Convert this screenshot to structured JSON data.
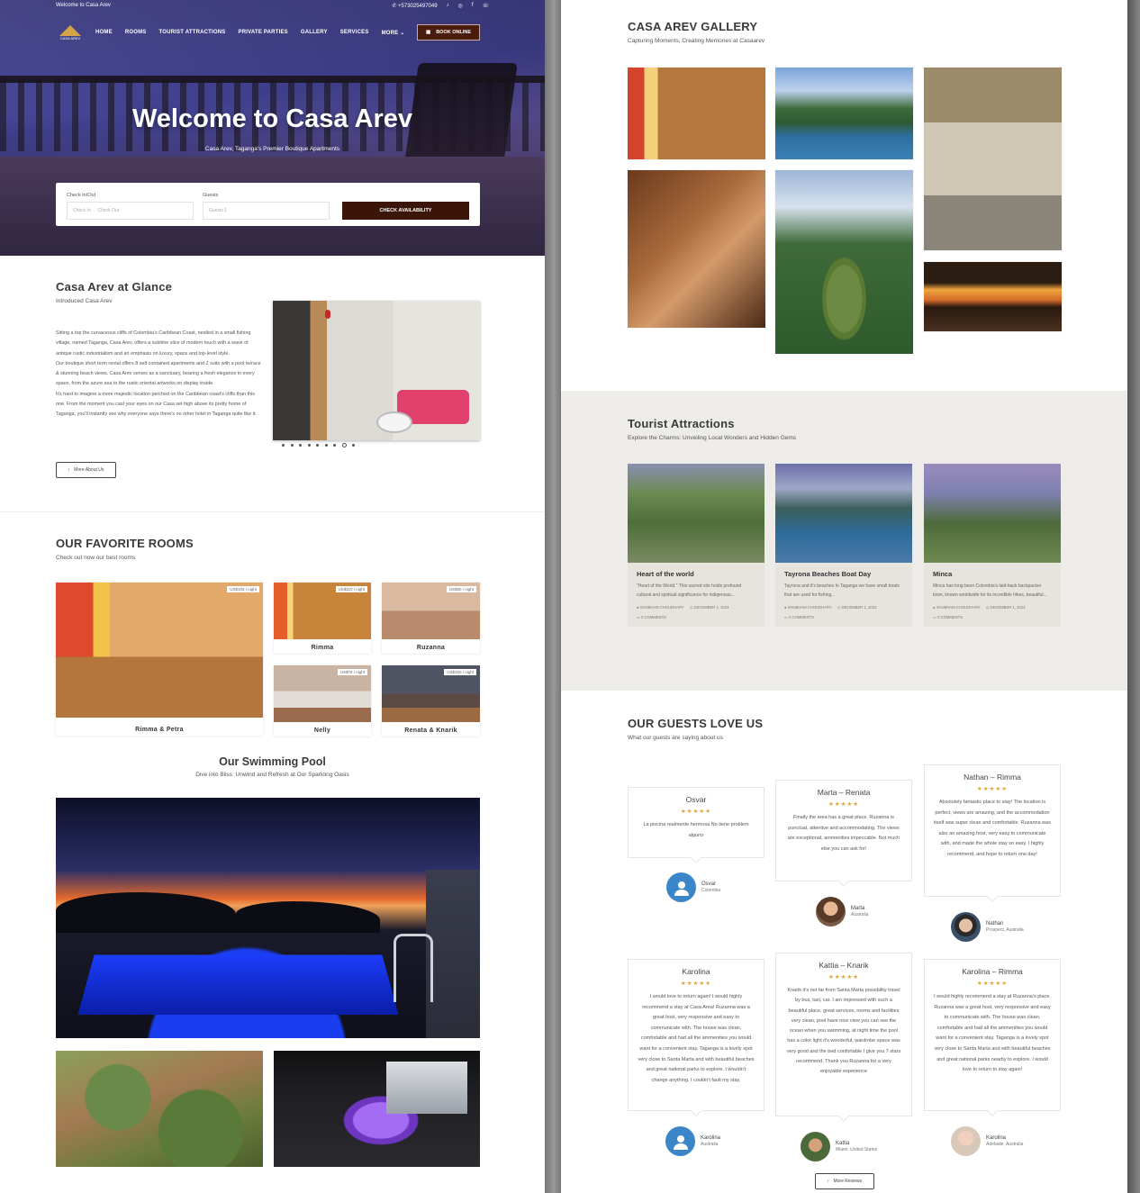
{
  "topbar": {
    "welcome": "Welcome to Casa Arev",
    "phone": "+573025497049",
    "social_icons": [
      "tiktok-icon",
      "instagram-icon",
      "facebook-icon",
      "whatsapp-icon"
    ]
  },
  "nav": {
    "logo_text": "CASA AREV",
    "items": [
      {
        "label": "HOME"
      },
      {
        "label": "ROOMS"
      },
      {
        "label": "TOURIST ATTRACTIONS"
      },
      {
        "label": "PRIVATE PARTIES"
      },
      {
        "label": "GALLERY"
      },
      {
        "label": "SERVICES"
      },
      {
        "label": "MORE"
      }
    ],
    "book_label": "BOOK ONLINE"
  },
  "hero": {
    "title": "Welcome to Casa Arev",
    "subtitle": "Casa Arev, Taganga's Premier Boutique Apartments"
  },
  "booking": {
    "checkin_label": "Check In/Out",
    "checkin_placeholder": "Check In → Check Out",
    "guests_label": "Guests",
    "guests_value": "Guests 1",
    "check_button": "CHECK AVAILABILITY"
  },
  "glance": {
    "title": "Casa Arev at Glance",
    "subtitle": "Introduced Casa Arev",
    "text": "Sitting a top the curvaceous cliffs of Colombia's Caribbean Coast, nestled in a small fishing village, named Taganga, Casa Arev, offers a sublime slice of modern touch with a wave of antique rustic industrialism and an emphasis on luxury, space and top-level style.\nOur boutique short term rental offers 8 self contained apartments and 2 suits with a pool terrace & stunning beach views. Casa Arev serves as a sanctuary, bearing a fresh elegance in every space, from the azure sea to the rustic oriental artworks on display inside.\nIt's hard to imagine a more majestic location perched on the Caribbean coast's cliffs than this one. From the moment you cast your eyes on our Casa set high above its pretty home of Taganga, you'll instantly see why everyone says there's no other hotel in Taganga quite like it.",
    "carousel_dots": 9,
    "carousel_active": 7,
    "more_button": "More About Us"
  },
  "rooms": {
    "title": "OUR FAVORITE ROOMS",
    "subtitle": "Check out now our best rooms",
    "items": [
      {
        "name": "Rimma & Petra",
        "price": "US$105 / night"
      },
      {
        "name": "Rimma",
        "price": "US$110 / night"
      },
      {
        "name": "Ruzanna",
        "price": "US$90 / night"
      },
      {
        "name": "Nelly",
        "price": "US$75 / night"
      },
      {
        "name": "Renata & Knarik",
        "price": "US$160 / night"
      }
    ]
  },
  "pool": {
    "title": "Our Swimming Pool",
    "subtitle": "Dive into Bliss: Unwind and Refresh at Our Sparkling Oasis"
  },
  "gallery": {
    "title": "CASA AREV GALLERY",
    "subtitle": "Capturing Moments, Creating Memories at Casaarev"
  },
  "attractions": {
    "title": "Tourist Attractions",
    "subtitle": "Explore the Charms: Unveiling Local Wonders and Hidden Gems",
    "cards": [
      {
        "title": "Heart of the world",
        "excerpt": "\"Heart of the World.\" This sacred site holds profound cultural and spiritual significance for indigenous...",
        "author": "SHUBHAM CHOUDHARY",
        "date": "DECEMBER 1, 2023",
        "comments": "0 COMMENTS"
      },
      {
        "title": "Tayrona Beaches Boat Day",
        "excerpt": "Tayrona and it's beaches In Taganga we have small boats that are used for fishing...",
        "author": "SHUBHAM CHOUDHARY",
        "date": "DECEMBER 1, 2023",
        "comments": "0 COMMENTS"
      },
      {
        "title": "Minca",
        "excerpt": "Minca has long been Colombia's laid-back backpacker town, known worldwide for its incredible hikes, beautiful...",
        "author": "SHUBHAM CHOUDHARY",
        "date": "DECEMBER 1, 2023",
        "comments": "0 COMMENTS"
      }
    ]
  },
  "guests": {
    "title": "OUR GUESTS LOVE US",
    "subtitle": "What our guests are saying about us",
    "reviews": [
      {
        "who": "Osvar",
        "text": "La piscina realmente hermosa No tiene problem alguno",
        "name": "Osvar",
        "location": "Colombia"
      },
      {
        "who": "Marta – Renata",
        "text": "Finally the area has a great place. Ruzanna is punctual, attentive and accommodating. The views are exceptional, ammenities impeccable. Not much else you can ask for!",
        "name": "Marta",
        "location": "Australia"
      },
      {
        "who": "Nathan – Rimma",
        "text": "Absolutely fantastic place to stay! The location is perfect, views are amazing, and the accommodation itself was super clean and comfortable. Ruzanna was also an amazing host, very easy to communicate with, and made the whole stay so easy. I highly recommend, and hope to return one day!",
        "name": "Nathan",
        "location": "Prospect, Australia"
      },
      {
        "who": "Karolina",
        "text": "I would love to return again! I would highly recommend a stay at Casa Area! Ruzanna was a great host, very responsive and easy to communicate with. The house was clean, comfortable and had all the ammenities you would want for a convenient stay. Taganga is a lovely spot very close to Santa Marta and with beautiful beaches and great national parks to explore. I wouldn't change anything. I couldn't fault my stay.",
        "name": "Karolina",
        "location": "Australia"
      },
      {
        "who": "Kattia – Knarik",
        "text": "Knarik it's not far from Santa Marta possibility travel by bus, taxi, car. I am impressed with such a beautiful place, great services, rooms and facilities very clean, pool have nice view you can see the ocean when you swimming, at night time the pool has a color light it's wonderful, wardrobe space was very good and the bed confortable I give you 7 stars recommend. Thank you Ruzanna for a very enjoyable experience",
        "name": "Kattia",
        "location": "Miami, United States"
      },
      {
        "who": "Karolina – Rimma",
        "text": "I would highly recommend a stay at Ruzanna's place. Ruzanna was a great host, very responsive and easy to communicate with. The house was clean, comfortable and had all the ammenities you would want for a convenient stay. Taganga is a lovely spot very close to Santa Marta and with beautiful beaches and great national parks nearby to explore. I would love to return to stay again!",
        "name": "Karolina",
        "location": "Adelaide, Australia"
      }
    ],
    "stars": "★★★★★",
    "more_button": "More Reviews"
  }
}
